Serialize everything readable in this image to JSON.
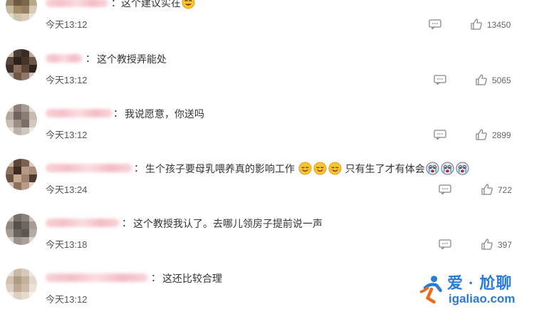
{
  "comments": [
    {
      "text": "这个建议实在",
      "time": "今天13:12",
      "likes": "13450",
      "emoji_after": [
        "smile"
      ]
    },
    {
      "text": "这个教授弄能处",
      "time": "今天13:12",
      "likes": "5065",
      "emoji_after": []
    },
    {
      "text": "我说愿意，你送吗",
      "time": "今天13:12",
      "likes": "2899",
      "emoji_after": []
    },
    {
      "text": "生个孩子要母乳喂养真的影响工作",
      "text2": "只有生了才有体会",
      "time": "今天13:24",
      "likes": "722"
    },
    {
      "text": "这个教授我认了。去哪儿领房子提前说一声",
      "time": "今天13:18",
      "likes": "397"
    },
    {
      "text": "这还比较合理",
      "time": "今天13:12",
      "likes": ""
    }
  ],
  "watermark": {
    "brand": "爱 · 尬聊",
    "domain": "igaliao.com"
  },
  "icons": {
    "reply": "comment-bubble-icon",
    "like": "thumbs-up-icon",
    "laugh": "smiling-face-emoji",
    "cry": "crying-face-emoji"
  },
  "colors": {
    "name_blur": "#f3b6c0",
    "brand_blue": "#2a7bd8",
    "brand_orange": "#ef6a1a"
  }
}
